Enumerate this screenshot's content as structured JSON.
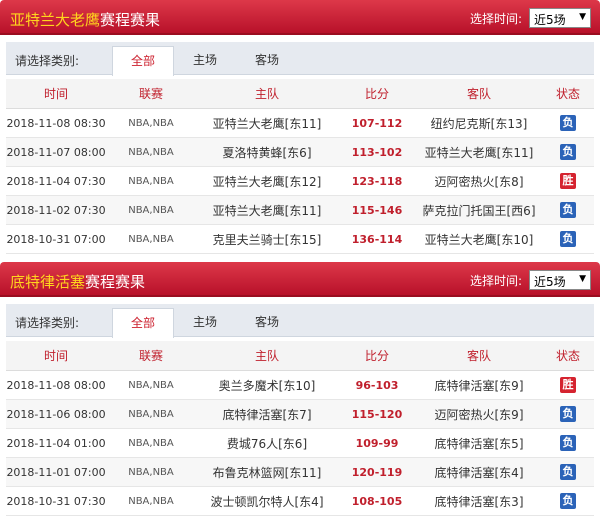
{
  "panels": [
    {
      "team": "亚特兰大老鹰",
      "title_suffix": "赛程赛果",
      "filter_label": "选择时间:",
      "filter_value": "近5场",
      "category_label": "请选择类别:",
      "tabs": [
        "全部",
        "主场",
        "客场"
      ],
      "active_tab": 0,
      "columns": [
        "时间",
        "联赛",
        "主队",
        "比分",
        "客队",
        "状态"
      ],
      "rows": [
        {
          "time": "2018-11-08 08:30",
          "league": "NBA,NBA",
          "home": "亚特兰大老鹰[东11]",
          "score": "107-112",
          "away": "纽约尼克斯[东13]",
          "status": "负"
        },
        {
          "time": "2018-11-07 08:00",
          "league": "NBA,NBA",
          "home": "夏洛特黄蜂[东6]",
          "score": "113-102",
          "away": "亚特兰大老鹰[东11]",
          "status": "负"
        },
        {
          "time": "2018-11-04 07:30",
          "league": "NBA,NBA",
          "home": "亚特兰大老鹰[东12]",
          "score": "123-118",
          "away": "迈阿密热火[东8]",
          "status": "胜"
        },
        {
          "time": "2018-11-02 07:30",
          "league": "NBA,NBA",
          "home": "亚特兰大老鹰[东11]",
          "score": "115-146",
          "away": "萨克拉门托国王[西6]",
          "status": "负"
        },
        {
          "time": "2018-10-31 07:00",
          "league": "NBA,NBA",
          "home": "克里夫兰骑士[东15]",
          "score": "136-114",
          "away": "亚特兰大老鹰[东10]",
          "status": "负"
        }
      ]
    },
    {
      "team": "底特律活塞",
      "title_suffix": "赛程赛果",
      "filter_label": "选择时间:",
      "filter_value": "近5场",
      "category_label": "请选择类别:",
      "tabs": [
        "全部",
        "主场",
        "客场"
      ],
      "active_tab": 0,
      "columns": [
        "时间",
        "联赛",
        "主队",
        "比分",
        "客队",
        "状态"
      ],
      "rows": [
        {
          "time": "2018-11-08 08:00",
          "league": "NBA,NBA",
          "home": "奥兰多魔术[东10]",
          "score": "96-103",
          "away": "底特律活塞[东9]",
          "status": "胜"
        },
        {
          "time": "2018-11-06 08:00",
          "league": "NBA,NBA",
          "home": "底特律活塞[东7]",
          "score": "115-120",
          "away": "迈阿密热火[东9]",
          "status": "负"
        },
        {
          "time": "2018-11-04 01:00",
          "league": "NBA,NBA",
          "home": "费城76人[东6]",
          "score": "109-99",
          "away": "底特律活塞[东5]",
          "status": "负"
        },
        {
          "time": "2018-11-01 07:00",
          "league": "NBA,NBA",
          "home": "布鲁克林篮网[东11]",
          "score": "120-119",
          "away": "底特律活塞[东4]",
          "status": "负"
        },
        {
          "time": "2018-10-31 07:30",
          "league": "NBA,NBA",
          "home": "波士顿凯尔特人[东4]",
          "score": "108-105",
          "away": "底特律活塞[东3]",
          "status": "负"
        }
      ]
    }
  ],
  "status_colors": {
    "负": "#2b63b8",
    "胜": "#d5232f"
  }
}
